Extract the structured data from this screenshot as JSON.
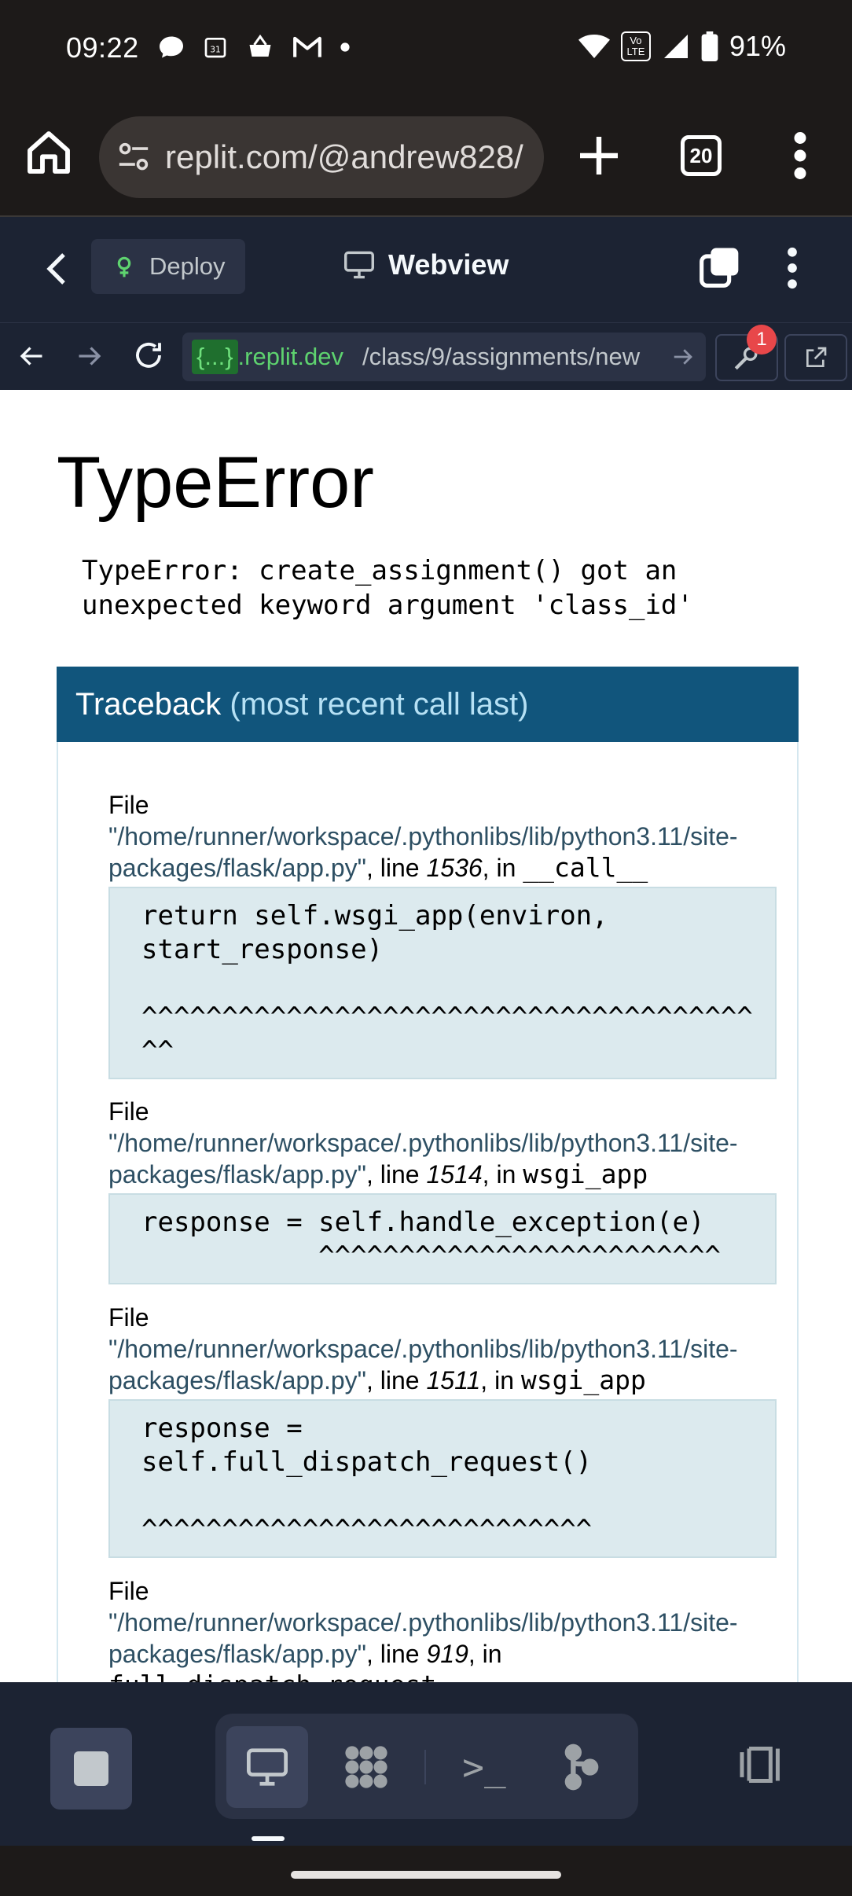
{
  "status_bar": {
    "time": "09:22",
    "battery": "91%",
    "left_icons": [
      "chat-icon",
      "calendar-icon",
      "basket-icon",
      "gmail-icon",
      "dot-icon"
    ],
    "right_icons": [
      "wifi-icon",
      "volte-icon",
      "signal-icon",
      "battery-icon"
    ],
    "volte_text": "Vo LTE",
    "calendar_text": "31"
  },
  "browser": {
    "url": "replit.com/@andrew828/",
    "tab_count": "20"
  },
  "replit_header": {
    "deploy_label": "Deploy",
    "title": "Webview"
  },
  "webview_nav": {
    "repl_token": "{...}",
    "domain": ".replit.dev",
    "path": "/class/9/assignments/new",
    "devtools_badge": "1"
  },
  "page": {
    "title": "TypeError",
    "message": "TypeError: create_assignment() got an\nunexpected keyword argument 'class_id'",
    "traceback_heading": "Traceback",
    "traceback_sub": "(most recent call last)",
    "frames": [
      {
        "file_word": "File",
        "path": "\"/home/runner/workspace/.pythonlibs/lib/python3.11/site-packages/flask/app.py\"",
        "line_word": ", line ",
        "line": "1536",
        "in_word": ", in ",
        "func": "__call__",
        "code": "return self.wsgi_app(environ,\nstart_response)\n\n^^^^^^^^^^^^^^^^^^^^^^^^^^^^^^^^^^^^^^\n^^"
      },
      {
        "file_word": "File",
        "path": "\"/home/runner/workspace/.pythonlibs/lib/python3.11/site-packages/flask/app.py\"",
        "line_word": ", line ",
        "line": "1514",
        "in_word": ", in ",
        "func": "wsgi_app",
        "code": "response = self.handle_exception(e)\n           ^^^^^^^^^^^^^^^^^^^^^^^^^"
      },
      {
        "file_word": "File",
        "path": "\"/home/runner/workspace/.pythonlibs/lib/python3.11/site-packages/flask/app.py\"",
        "line_word": ", line ",
        "line": "1511",
        "in_word": ", in ",
        "func": "wsgi_app",
        "code": "response =\nself.full_dispatch_request()\n\n^^^^^^^^^^^^^^^^^^^^^^^^^^^^"
      },
      {
        "file_word": "File",
        "path": "\"/home/runner/workspace/.pythonlibs/lib/python3.11/site-packages/flask/app.py\"",
        "line_word": ", line ",
        "line": "919",
        "in_word": ", in",
        "func": "full_dispatch_request",
        "code": ""
      }
    ]
  },
  "bottom_bar": {
    "tabs": [
      "webview-tab",
      "workspace-tab",
      "shell-tab",
      "git-tab"
    ],
    "active_tab": "webview-tab",
    "shell_glyph": ">_"
  },
  "colors": {
    "status_bg": "#1d1a19",
    "replit_bg": "#1c2333",
    "traceback_header": "#11557c",
    "traceback_sub": "#b6e1f5",
    "code_bg": "#dceaee",
    "domain_green": "#5ed36f",
    "badge_red": "#e8474a"
  }
}
